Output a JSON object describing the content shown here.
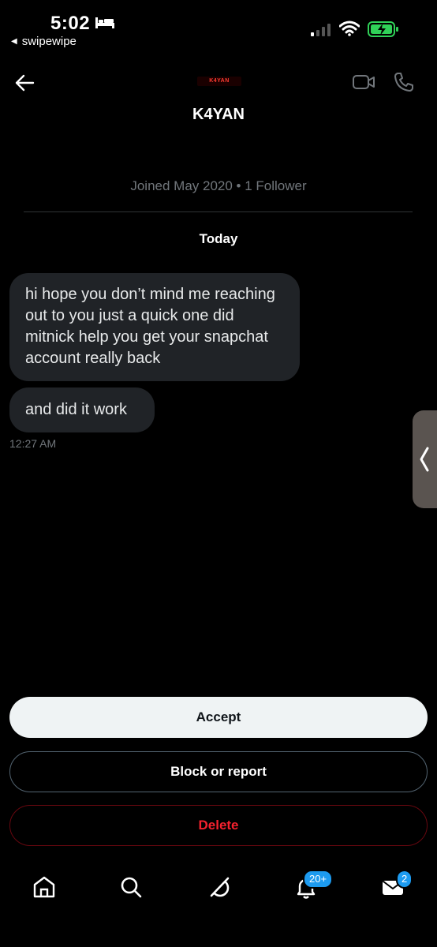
{
  "status_bar": {
    "time": "5:02",
    "back_app": "swipewipe"
  },
  "header": {
    "logo_text": "K4YAN",
    "name": "K4YAN",
    "joined": "Joined May 2020 • 1 Follower"
  },
  "conversation": {
    "date_label": "Today",
    "messages": [
      {
        "text": "hi hope you don’t mind me reaching out to you just a quick one did mitnick help you get your snapchat account really back"
      },
      {
        "text": "and did it work"
      }
    ],
    "timestamp": "12:27 AM"
  },
  "actions": {
    "accept_label": "Accept",
    "block_label": "Block or report",
    "delete_label": "Delete"
  },
  "bottom_nav": {
    "notifications_badge": "20+",
    "messages_badge": "2"
  },
  "colors": {
    "background": "#000000",
    "bubble": "#202327",
    "accent": "#1d9bf0",
    "danger": "#f4212e"
  }
}
